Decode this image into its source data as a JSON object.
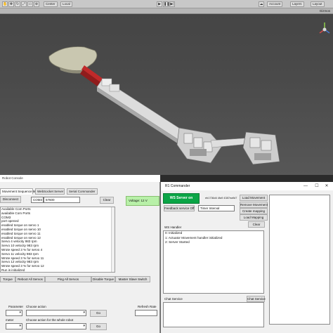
{
  "unity": {
    "toolbar": {
      "center_label": "Center",
      "local_label": "Local",
      "account_label": "Account",
      "layers_label": "Layers",
      "layout_label": "Layout"
    },
    "scene": {
      "gizmos_label": "Gizmos"
    }
  },
  "console": {
    "title": "Robot Console",
    "tabs": [
      "Movement Sequence Maker",
      "WebSocket Server",
      "Serial Commander"
    ],
    "disconnect_label": "Disconnect",
    "port_label": "COM3",
    "baud_value": "57600",
    "clear_label": "Clear",
    "voltage_text": "Voltage: 12 V",
    "log_lines": [
      "Available Com Ports",
      "available Com Ports",
      "COM3",
      "port opened",
      "enabled torque on servo 1",
      "enabled torque on servo 10",
      "enabled torque on servo 11",
      "enabled torque on servo 12",
      "Servo 4 velocity 983 rpm",
      "Servo 10 velocity 983 rpm",
      "Wrote speed 3 % for servo 4",
      "Servo 11 velocity 983 rpm",
      "Wrote speed 3 % for servo 11",
      "Servo 12 velocity 983 rpm",
      "Wrote speed 3 % for servo 12",
      "Run is initialized"
    ],
    "commands": [
      "Torque",
      "Reboot All Servos",
      "Ping All Servos",
      "Disable Torque",
      "Master Slave Switch"
    ],
    "parameter_label": "Parameter",
    "choose_action_label": "Choose action",
    "refresh_rate_label": "Refresh Rate",
    "go_label": "Go",
    "meter_label": "meter",
    "choose_whole_label": "Choose action for the whole robot",
    "go2_label": "Go"
  },
  "commander": {
    "title": "R1 Commander",
    "ws_button_label": "WS Server on",
    "guid_text": "eb1736d4 4fa9 4387ea9d7",
    "feedback_label": "Feedback service Off",
    "timer_label": "Timer Interval",
    "movement_buttons": [
      "Load Movement",
      "Remove Movement",
      "Create mapping",
      "Load Mapping"
    ],
    "clear_label": "Clear",
    "ws_handler_label": "WS Handler",
    "ws_lines": [
      "0: Initialized",
      "1: Actuator Movement handler initialized",
      "2: Server Started"
    ],
    "chat_label": "Chat Service",
    "chat_service_button": "Chat Service"
  }
}
